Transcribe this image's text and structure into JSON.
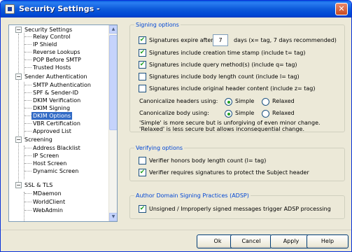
{
  "window": {
    "title": "Security Settings -",
    "close_glyph": "✕"
  },
  "tree": {
    "items": [
      {
        "label": "Security Settings",
        "level": 0,
        "expander": "−"
      },
      {
        "label": "Relay Control",
        "level": 1
      },
      {
        "label": "IP Shield",
        "level": 1
      },
      {
        "label": "Reverse Lookups",
        "level": 1
      },
      {
        "label": "POP Before SMTP",
        "level": 1
      },
      {
        "label": "Trusted Hosts",
        "level": 1
      },
      {
        "label": "Sender Authentication",
        "level": 0,
        "expander": "−"
      },
      {
        "label": "SMTP Authentication",
        "level": 1
      },
      {
        "label": "SPF & Sender-ID",
        "level": 1
      },
      {
        "label": "DKIM Verification",
        "level": 1
      },
      {
        "label": "DKIM Signing",
        "level": 1
      },
      {
        "label": "DKIM Options",
        "level": 1,
        "selected": true
      },
      {
        "label": "VBR Certification",
        "level": 1
      },
      {
        "label": "Approved List",
        "level": 1
      },
      {
        "label": "Screening",
        "level": 0,
        "expander": "−"
      },
      {
        "label": "Address Blacklist",
        "level": 1
      },
      {
        "label": "IP Screen",
        "level": 1
      },
      {
        "label": "Host Screen",
        "level": 1
      },
      {
        "label": "Dynamic Screen",
        "level": 1
      },
      {
        "label": "SSL & TLS",
        "level": 0,
        "expander": "−"
      },
      {
        "label": "MDaemon",
        "level": 1
      },
      {
        "label": "WorldClient",
        "level": 1
      },
      {
        "label": "WebAdmin",
        "level": 1
      }
    ],
    "scroll_up": "▲",
    "scroll_down": "▼"
  },
  "signing": {
    "title": "Signing options",
    "expire_label": "Signatures expire after",
    "expire_days": "7",
    "expire_hint": "days (x= tag, 7 days recommended)",
    "checks": [
      {
        "label": "Signatures expire after",
        "checked": true
      },
      {
        "label": "Signatures include creation time stamp (include t= tag)",
        "checked": true
      },
      {
        "label": "Signatures include query method(s) (include q= tag)",
        "checked": true
      },
      {
        "label": "Signatures include body length count (include l= tag)",
        "checked": false
      },
      {
        "label": "Signatures include original header content (include z= tag)",
        "checked": false
      }
    ],
    "canon_headers_label": "Canonicalize headers using:",
    "canon_body_label": "Canonicalize body using:",
    "simple": "Simple",
    "relaxed": "Relaxed",
    "note_line1": "'Simple' is more secure but is unforgiving of even minor change.",
    "note_line2": "'Relaxed' is less secure but allows inconsequential change."
  },
  "verifying": {
    "title": "Verifying options",
    "checks": [
      {
        "label": "Verifier honors body length count (l= tag)",
        "checked": false
      },
      {
        "label": "Verifier requires signatures to protect the Subject header",
        "checked": true
      }
    ]
  },
  "adsp": {
    "title": "Author Domain Signing Practices (ADSP)",
    "checks": [
      {
        "label": "Unsigned / Improperly signed messages trigger ADSP processing",
        "checked": true
      }
    ]
  },
  "buttons": {
    "ok": "Ok",
    "cancel": "Cancel",
    "apply": "Apply",
    "help": "Help"
  },
  "check_glyph": "✔"
}
